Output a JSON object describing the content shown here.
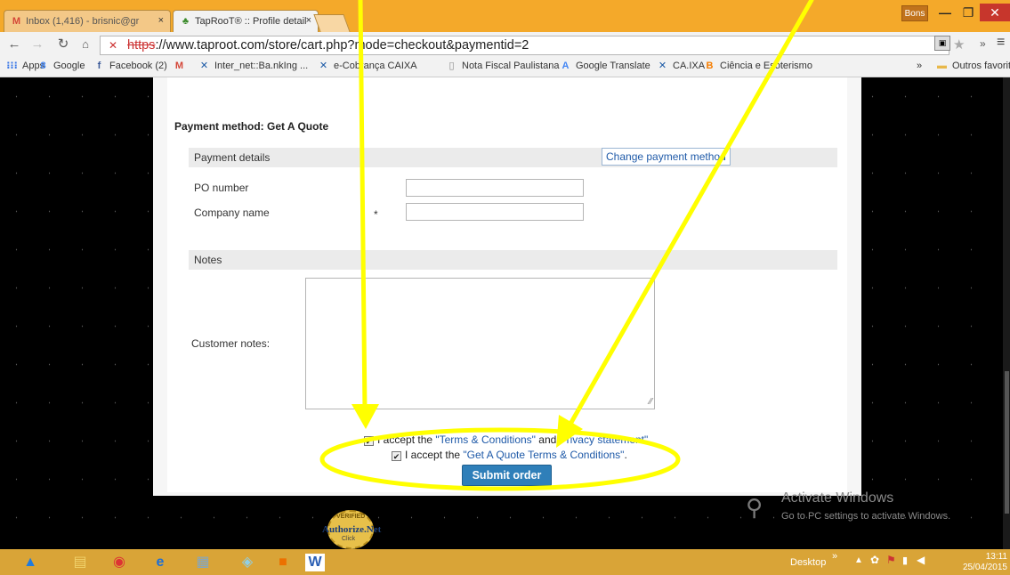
{
  "browser": {
    "tabs": [
      {
        "label": "Inbox (1,416) - brisnic@gr",
        "close": "×"
      },
      {
        "label": "TapRooT® :: Profile detail",
        "close": "×"
      }
    ],
    "user_badge": "Bons",
    "window_controls": {
      "minimize": "—",
      "restore": "❐",
      "close": "✕"
    },
    "url": {
      "scheme": "https",
      "rest": "://www.taproot.com/store/cart.php?mode=checkout&paymentid=2"
    },
    "bookmarks": [
      {
        "label": "Apps",
        "icon": "apps-icon",
        "glyph": "⁝⁝⁝",
        "color": "#3b78e7"
      },
      {
        "label": "Google",
        "icon": "google-icon",
        "glyph": "8",
        "color": "#4285f4"
      },
      {
        "label": "Facebook (2)",
        "icon": "facebook-icon",
        "glyph": "f",
        "color": "#3b5998"
      },
      {
        "label": "",
        "icon": "gmail-icon",
        "glyph": "M",
        "color": "#d44638"
      },
      {
        "label": "Inter_net::Ba.nkIng ...",
        "icon": "caixa-icon",
        "glyph": "✕",
        "color": "#1c5aa6"
      },
      {
        "label": "e-Cobrança CAIXA",
        "icon": "caixa-icon",
        "glyph": "✕",
        "color": "#1c5aa6"
      },
      {
        "label": "Nota Fiscal Paulistana",
        "icon": "page-icon",
        "glyph": "▯",
        "color": "#888"
      },
      {
        "label": "Google Translate",
        "icon": "translate-icon",
        "glyph": "A",
        "color": "#4285f4"
      },
      {
        "label": "CA.IXA",
        "icon": "caixa-icon",
        "glyph": "✕",
        "color": "#1c5aa6"
      },
      {
        "label": "Ciência e Esoterismo",
        "icon": "blogger-icon",
        "glyph": "B",
        "color": "#f57d00"
      }
    ],
    "bookmarks_more": "»",
    "other_bookmarks": "Outros favoritos"
  },
  "page": {
    "payment_method_title": "Payment method: Get A Quote",
    "payment_details_header": "Payment details",
    "change_payment_method": "Change payment method",
    "po_number_label": "PO number",
    "company_name_label": "Company name",
    "required_mark": "*",
    "notes_header": "Notes",
    "customer_notes_label": "Customer notes:",
    "terms1": {
      "prefix": "I accept the ",
      "link1": "\"Terms & Conditions\"",
      "mid": " and ",
      "link2": "Privacy statement\""
    },
    "terms2": {
      "prefix": "I accept the ",
      "link": "\"Get A Quote Terms & Conditions\"",
      "suffix": "."
    },
    "submit_label": "Submit order",
    "authorize": {
      "top": "VERIFIED",
      "name": "Authorize.Net",
      "click": "Click"
    },
    "watermark": {
      "title": "Activate Windows",
      "subtitle": "Go to PC settings to activate Windows."
    }
  },
  "taskbar": {
    "desktop_label": "Desktop",
    "time": "13:11",
    "date": "25/04/2015"
  },
  "colors": {
    "annotation": "#ffff00",
    "titlebar": "#f4a92a",
    "link": "#1f5aa8",
    "submit": "#2f7fb9"
  }
}
